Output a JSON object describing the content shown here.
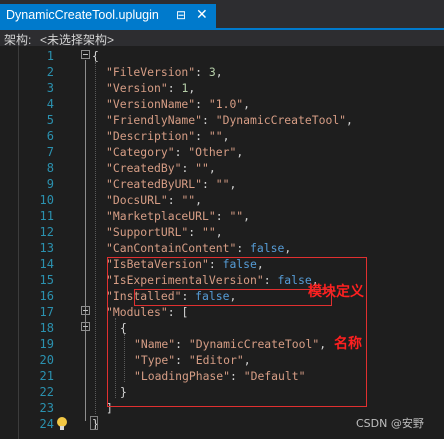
{
  "tab": {
    "title": "DynamicCreateTool.uplugin",
    "pin": "⊟",
    "close": "✕"
  },
  "arch_bar": {
    "label": "架构:",
    "selection": "<未选择架构>"
  },
  "code": {
    "line_numbers": [
      "1",
      "2",
      "3",
      "4",
      "5",
      "6",
      "7",
      "8",
      "9",
      "10",
      "11",
      "12",
      "13",
      "14",
      "15",
      "16",
      "17",
      "18",
      "19",
      "20",
      "21",
      "22",
      "23",
      "24"
    ],
    "lines": [
      {
        "tokens": [
          {
            "t": "{",
            "c": "p"
          }
        ]
      },
      {
        "tokens": [
          {
            "t": "\"FileVersion\"",
            "c": "k"
          },
          {
            "t": ": ",
            "c": "p"
          },
          {
            "t": "3",
            "c": "n"
          },
          {
            "t": ",",
            "c": "p"
          }
        ]
      },
      {
        "tokens": [
          {
            "t": "\"Version\"",
            "c": "k"
          },
          {
            "t": ": ",
            "c": "p"
          },
          {
            "t": "1",
            "c": "n"
          },
          {
            "t": ",",
            "c": "p"
          }
        ]
      },
      {
        "tokens": [
          {
            "t": "\"VersionName\"",
            "c": "k"
          },
          {
            "t": ": ",
            "c": "p"
          },
          {
            "t": "\"1.0\"",
            "c": "s"
          },
          {
            "t": ",",
            "c": "p"
          }
        ]
      },
      {
        "tokens": [
          {
            "t": "\"FriendlyName\"",
            "c": "k"
          },
          {
            "t": ": ",
            "c": "p"
          },
          {
            "t": "\"DynamicCreateTool\"",
            "c": "s"
          },
          {
            "t": ",",
            "c": "p"
          }
        ]
      },
      {
        "tokens": [
          {
            "t": "\"Description\"",
            "c": "k"
          },
          {
            "t": ": ",
            "c": "p"
          },
          {
            "t": "\"\"",
            "c": "s"
          },
          {
            "t": ",",
            "c": "p"
          }
        ]
      },
      {
        "tokens": [
          {
            "t": "\"Category\"",
            "c": "k"
          },
          {
            "t": ": ",
            "c": "p"
          },
          {
            "t": "\"Other\"",
            "c": "s"
          },
          {
            "t": ",",
            "c": "p"
          }
        ]
      },
      {
        "tokens": [
          {
            "t": "\"CreatedBy\"",
            "c": "k"
          },
          {
            "t": ": ",
            "c": "p"
          },
          {
            "t": "\"\"",
            "c": "s"
          },
          {
            "t": ",",
            "c": "p"
          }
        ]
      },
      {
        "tokens": [
          {
            "t": "\"CreatedByURL\"",
            "c": "k"
          },
          {
            "t": ": ",
            "c": "p"
          },
          {
            "t": "\"\"",
            "c": "s"
          },
          {
            "t": ",",
            "c": "p"
          }
        ]
      },
      {
        "tokens": [
          {
            "t": "\"DocsURL\"",
            "c": "k"
          },
          {
            "t": ": ",
            "c": "p"
          },
          {
            "t": "\"\"",
            "c": "s"
          },
          {
            "t": ",",
            "c": "p"
          }
        ]
      },
      {
        "tokens": [
          {
            "t": "\"MarketplaceURL\"",
            "c": "k"
          },
          {
            "t": ": ",
            "c": "p"
          },
          {
            "t": "\"\"",
            "c": "s"
          },
          {
            "t": ",",
            "c": "p"
          }
        ]
      },
      {
        "tokens": [
          {
            "t": "\"SupportURL\"",
            "c": "k"
          },
          {
            "t": ": ",
            "c": "p"
          },
          {
            "t": "\"\"",
            "c": "s"
          },
          {
            "t": ",",
            "c": "p"
          }
        ]
      },
      {
        "tokens": [
          {
            "t": "\"CanContainContent\"",
            "c": "k"
          },
          {
            "t": ": ",
            "c": "p"
          },
          {
            "t": "false",
            "c": "b"
          },
          {
            "t": ",",
            "c": "p"
          }
        ]
      },
      {
        "tokens": [
          {
            "t": "\"IsBetaVersion\"",
            "c": "k"
          },
          {
            "t": ": ",
            "c": "p"
          },
          {
            "t": "false",
            "c": "b"
          },
          {
            "t": ",",
            "c": "p"
          }
        ]
      },
      {
        "tokens": [
          {
            "t": "\"IsExperimentalVersion\"",
            "c": "k"
          },
          {
            "t": ": ",
            "c": "p"
          },
          {
            "t": "false",
            "c": "b"
          },
          {
            "t": ",",
            "c": "p"
          }
        ]
      },
      {
        "tokens": [
          {
            "t": "\"Installed\"",
            "c": "k"
          },
          {
            "t": ": ",
            "c": "p"
          },
          {
            "t": "false",
            "c": "b"
          },
          {
            "t": ",",
            "c": "p"
          }
        ]
      },
      {
        "tokens": [
          {
            "t": "\"Modules\"",
            "c": "k"
          },
          {
            "t": ": [",
            "c": "p"
          }
        ]
      },
      {
        "tokens": [
          {
            "t": "{",
            "c": "p"
          }
        ]
      },
      {
        "tokens": [
          {
            "t": "\"Name\"",
            "c": "k"
          },
          {
            "t": ": ",
            "c": "p"
          },
          {
            "t": "\"DynamicCreateTool\"",
            "c": "s"
          },
          {
            "t": ",",
            "c": "p"
          }
        ]
      },
      {
        "tokens": [
          {
            "t": "\"Type\"",
            "c": "k"
          },
          {
            "t": ": ",
            "c": "p"
          },
          {
            "t": "\"Editor\"",
            "c": "s"
          },
          {
            "t": ",",
            "c": "p"
          }
        ]
      },
      {
        "tokens": [
          {
            "t": "\"LoadingPhase\"",
            "c": "k"
          },
          {
            "t": ": ",
            "c": "p"
          },
          {
            "t": "\"Default\"",
            "c": "s"
          }
        ]
      },
      {
        "tokens": [
          {
            "t": "}",
            "c": "p"
          }
        ]
      },
      {
        "tokens": [
          {
            "t": "]",
            "c": "p"
          }
        ]
      },
      {
        "tokens": [
          {
            "t": "}",
            "c": "p"
          }
        ]
      }
    ]
  },
  "annotations": {
    "modules_label": "模块定义",
    "name_label": "名称"
  },
  "watermark": "CSDN @安野",
  "colors": {
    "tab_active": "#007acc",
    "editor_bg": "#1e1e1e",
    "line_number": "#2b91af",
    "string": "#d69d85",
    "number": "#b5cea8",
    "keyword": "#569cd6",
    "annotation": "#e03030"
  }
}
